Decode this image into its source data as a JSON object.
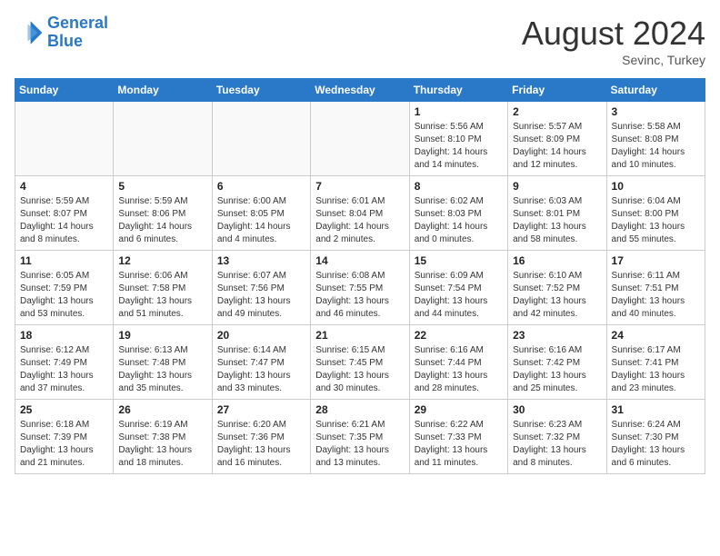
{
  "header": {
    "logo_line1": "General",
    "logo_line2": "Blue",
    "month_year": "August 2024",
    "location": "Sevinc, Turkey"
  },
  "days_of_week": [
    "Sunday",
    "Monday",
    "Tuesday",
    "Wednesday",
    "Thursday",
    "Friday",
    "Saturday"
  ],
  "weeks": [
    [
      {
        "day": "",
        "info": ""
      },
      {
        "day": "",
        "info": ""
      },
      {
        "day": "",
        "info": ""
      },
      {
        "day": "",
        "info": ""
      },
      {
        "day": "1",
        "info": "Sunrise: 5:56 AM\nSunset: 8:10 PM\nDaylight: 14 hours\nand 14 minutes."
      },
      {
        "day": "2",
        "info": "Sunrise: 5:57 AM\nSunset: 8:09 PM\nDaylight: 14 hours\nand 12 minutes."
      },
      {
        "day": "3",
        "info": "Sunrise: 5:58 AM\nSunset: 8:08 PM\nDaylight: 14 hours\nand 10 minutes."
      }
    ],
    [
      {
        "day": "4",
        "info": "Sunrise: 5:59 AM\nSunset: 8:07 PM\nDaylight: 14 hours\nand 8 minutes."
      },
      {
        "day": "5",
        "info": "Sunrise: 5:59 AM\nSunset: 8:06 PM\nDaylight: 14 hours\nand 6 minutes."
      },
      {
        "day": "6",
        "info": "Sunrise: 6:00 AM\nSunset: 8:05 PM\nDaylight: 14 hours\nand 4 minutes."
      },
      {
        "day": "7",
        "info": "Sunrise: 6:01 AM\nSunset: 8:04 PM\nDaylight: 14 hours\nand 2 minutes."
      },
      {
        "day": "8",
        "info": "Sunrise: 6:02 AM\nSunset: 8:03 PM\nDaylight: 14 hours\nand 0 minutes."
      },
      {
        "day": "9",
        "info": "Sunrise: 6:03 AM\nSunset: 8:01 PM\nDaylight: 13 hours\nand 58 minutes."
      },
      {
        "day": "10",
        "info": "Sunrise: 6:04 AM\nSunset: 8:00 PM\nDaylight: 13 hours\nand 55 minutes."
      }
    ],
    [
      {
        "day": "11",
        "info": "Sunrise: 6:05 AM\nSunset: 7:59 PM\nDaylight: 13 hours\nand 53 minutes."
      },
      {
        "day": "12",
        "info": "Sunrise: 6:06 AM\nSunset: 7:58 PM\nDaylight: 13 hours\nand 51 minutes."
      },
      {
        "day": "13",
        "info": "Sunrise: 6:07 AM\nSunset: 7:56 PM\nDaylight: 13 hours\nand 49 minutes."
      },
      {
        "day": "14",
        "info": "Sunrise: 6:08 AM\nSunset: 7:55 PM\nDaylight: 13 hours\nand 46 minutes."
      },
      {
        "day": "15",
        "info": "Sunrise: 6:09 AM\nSunset: 7:54 PM\nDaylight: 13 hours\nand 44 minutes."
      },
      {
        "day": "16",
        "info": "Sunrise: 6:10 AM\nSunset: 7:52 PM\nDaylight: 13 hours\nand 42 minutes."
      },
      {
        "day": "17",
        "info": "Sunrise: 6:11 AM\nSunset: 7:51 PM\nDaylight: 13 hours\nand 40 minutes."
      }
    ],
    [
      {
        "day": "18",
        "info": "Sunrise: 6:12 AM\nSunset: 7:49 PM\nDaylight: 13 hours\nand 37 minutes."
      },
      {
        "day": "19",
        "info": "Sunrise: 6:13 AM\nSunset: 7:48 PM\nDaylight: 13 hours\nand 35 minutes."
      },
      {
        "day": "20",
        "info": "Sunrise: 6:14 AM\nSunset: 7:47 PM\nDaylight: 13 hours\nand 33 minutes."
      },
      {
        "day": "21",
        "info": "Sunrise: 6:15 AM\nSunset: 7:45 PM\nDaylight: 13 hours\nand 30 minutes."
      },
      {
        "day": "22",
        "info": "Sunrise: 6:16 AM\nSunset: 7:44 PM\nDaylight: 13 hours\nand 28 minutes."
      },
      {
        "day": "23",
        "info": "Sunrise: 6:16 AM\nSunset: 7:42 PM\nDaylight: 13 hours\nand 25 minutes."
      },
      {
        "day": "24",
        "info": "Sunrise: 6:17 AM\nSunset: 7:41 PM\nDaylight: 13 hours\nand 23 minutes."
      }
    ],
    [
      {
        "day": "25",
        "info": "Sunrise: 6:18 AM\nSunset: 7:39 PM\nDaylight: 13 hours\nand 21 minutes."
      },
      {
        "day": "26",
        "info": "Sunrise: 6:19 AM\nSunset: 7:38 PM\nDaylight: 13 hours\nand 18 minutes."
      },
      {
        "day": "27",
        "info": "Sunrise: 6:20 AM\nSunset: 7:36 PM\nDaylight: 13 hours\nand 16 minutes."
      },
      {
        "day": "28",
        "info": "Sunrise: 6:21 AM\nSunset: 7:35 PM\nDaylight: 13 hours\nand 13 minutes."
      },
      {
        "day": "29",
        "info": "Sunrise: 6:22 AM\nSunset: 7:33 PM\nDaylight: 13 hours\nand 11 minutes."
      },
      {
        "day": "30",
        "info": "Sunrise: 6:23 AM\nSunset: 7:32 PM\nDaylight: 13 hours\nand 8 minutes."
      },
      {
        "day": "31",
        "info": "Sunrise: 6:24 AM\nSunset: 7:30 PM\nDaylight: 13 hours\nand 6 minutes."
      }
    ]
  ]
}
